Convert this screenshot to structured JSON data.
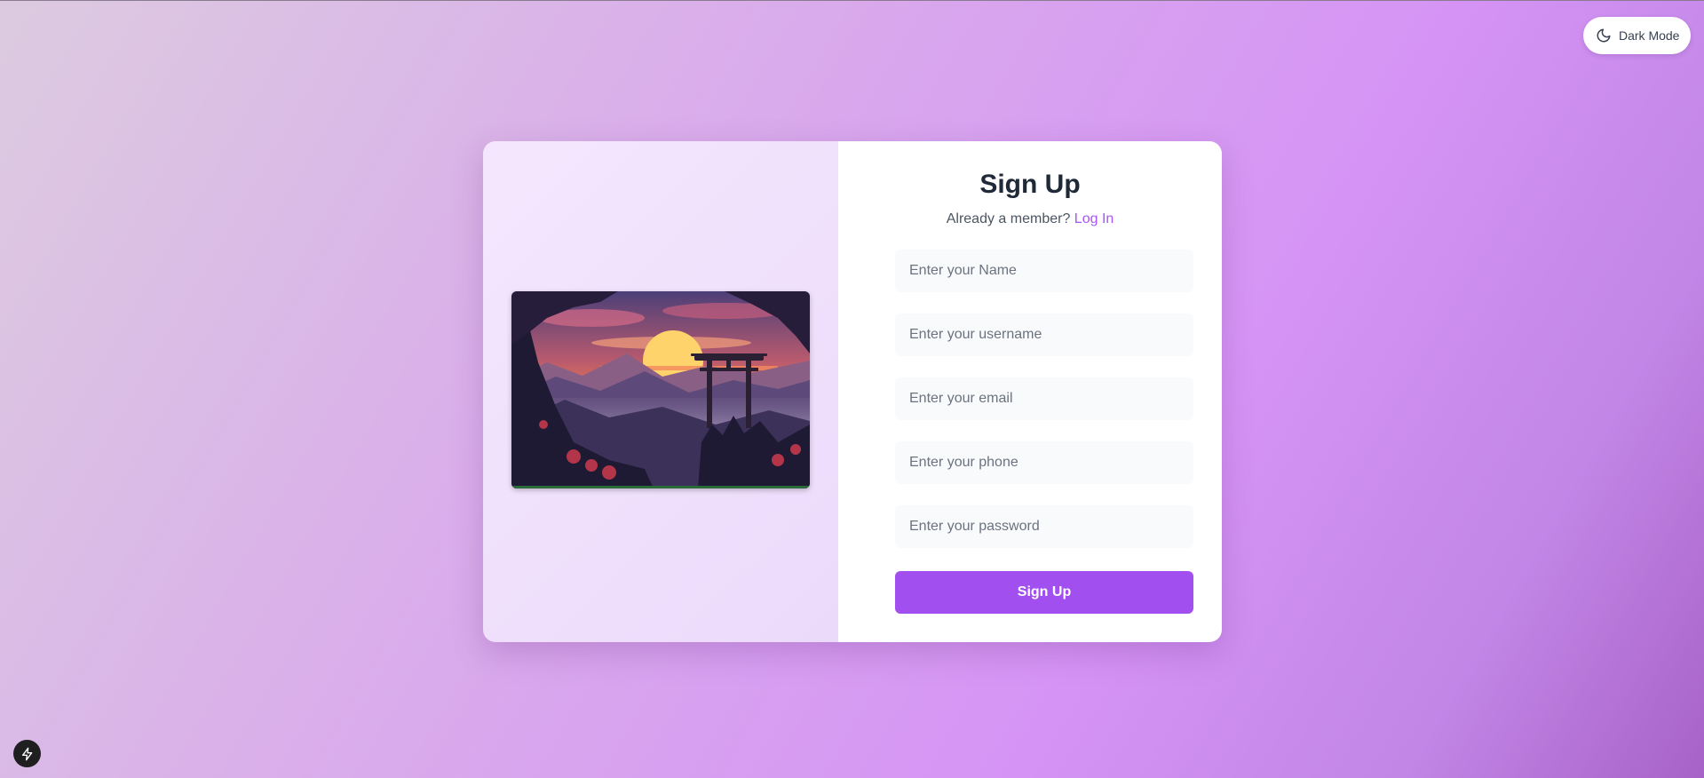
{
  "toolbar": {
    "dark_mode_label": "Dark Mode",
    "dark_mode_icon": "moon-icon"
  },
  "card": {
    "illustration": {
      "icon": "landscape-illustration",
      "palette": {
        "sky_top": "#5b4a8a",
        "sky_glow": "#f07a4a",
        "sun": "#ffd36b",
        "mountains": "#4a3d6b",
        "foreground": "#1f1a33",
        "foliage_accent": "#c2384d"
      }
    },
    "form": {
      "title": "Sign Up",
      "member_prompt": "Already a member?",
      "login_link": "Log In",
      "fields": {
        "name": {
          "placeholder": "Enter your Name",
          "value": ""
        },
        "username": {
          "placeholder": "Enter your username",
          "value": ""
        },
        "email": {
          "placeholder": "Enter your email",
          "value": ""
        },
        "phone": {
          "placeholder": "Enter your phone",
          "value": ""
        },
        "password": {
          "placeholder": "Enter your password",
          "value": ""
        }
      },
      "submit_label": "Sign Up"
    }
  },
  "colors": {
    "accent": "#a24ff0",
    "link": "#a855f7",
    "title": "#1f2937"
  },
  "badge": {
    "icon": "lightning-bolt-icon"
  }
}
